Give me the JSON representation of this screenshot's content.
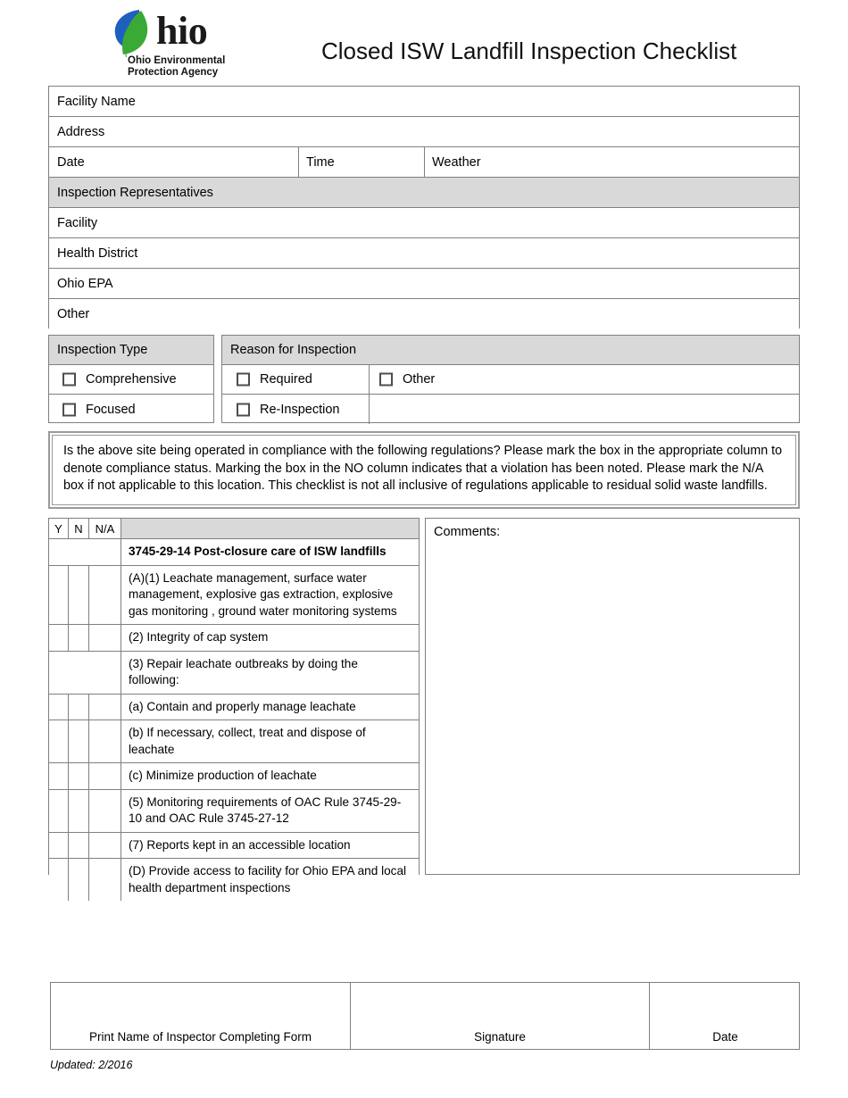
{
  "header": {
    "logo": {
      "wordmark": "hio",
      "agency_line1": "Ohio Environmental",
      "agency_line2": "Protection Agency",
      "leaf_blue": "#1f5fbf",
      "leaf_green": "#3aa935"
    },
    "title": "Closed ISW Landfill Inspection Checklist"
  },
  "facility_table": {
    "rows": [
      {
        "label": "Facility Name"
      },
      {
        "label": "Address"
      }
    ],
    "date_row": {
      "date_label": "Date",
      "time_label": "Time",
      "weather_label": "Weather"
    },
    "representatives_header": "Inspection Representatives",
    "representatives": [
      {
        "label": "Facility"
      },
      {
        "label": "Health District"
      },
      {
        "label": "Ohio EPA"
      },
      {
        "label": "Other"
      }
    ]
  },
  "inspection_type": {
    "header": "Inspection Type",
    "options": [
      {
        "label": "Comprehensive",
        "checked": false
      },
      {
        "label": "Focused",
        "checked": false
      }
    ]
  },
  "reason_for_inspection": {
    "header": "Reason for Inspection",
    "options_left": [
      {
        "label": "Required",
        "checked": false
      },
      {
        "label": "Re-Inspection",
        "checked": false
      }
    ],
    "options_right": [
      {
        "label": "Other",
        "checked": false
      }
    ]
  },
  "instructions": {
    "text": "Is the above site being operated  in compliance with the following regulations?  Please mark the box in the appropriate column to denote compliance status.  Marking the box in the NO column indicates that a violation has been noted.  Please mark the N/A box if not applicable to this location.  This checklist is not all inclusive of regulations applicable to residual solid waste landfills."
  },
  "checklist": {
    "columns": {
      "yes": "Y",
      "no": "N",
      "na": "N/A",
      "description": ""
    },
    "rows": [
      {
        "type": "section",
        "text": "3745-29-14 Post-closure care of ISW landfills",
        "yes": "",
        "no": "",
        "na": ""
      },
      {
        "type": "item",
        "text": "(A)(1) Leachate management, surface water management, explosive gas extraction, explosive gas monitoring , ground water monitoring systems",
        "yes": "",
        "no": "",
        "na": ""
      },
      {
        "type": "item",
        "text": "(2) Integrity of cap system",
        "yes": "",
        "no": "",
        "na": ""
      },
      {
        "type": "span",
        "text": "(3) Repair leachate outbreaks by doing the following:",
        "yes": "",
        "no": "",
        "na": ""
      },
      {
        "type": "item",
        "text": "(a) Contain and properly manage leachate",
        "yes": "",
        "no": "",
        "na": ""
      },
      {
        "type": "item",
        "text": "(b) If necessary, collect, treat and dispose of leachate",
        "yes": "",
        "no": "",
        "na": ""
      },
      {
        "type": "item",
        "text": "(c) Minimize production of leachate",
        "yes": "",
        "no": "",
        "na": ""
      },
      {
        "type": "item",
        "text": "(5) Monitoring requirements of OAC Rule 3745-29-10 and OAC Rule 3745-27-12",
        "yes": "",
        "no": "",
        "na": ""
      },
      {
        "type": "item",
        "text": "(7) Reports kept in an accessible location",
        "yes": "",
        "no": "",
        "na": ""
      },
      {
        "type": "item",
        "text": "(D) Provide access to facility for Ohio EPA and local health department inspections",
        "yes": "",
        "no": "",
        "na": ""
      }
    ]
  },
  "comments": {
    "label": "Comments:",
    "value": ""
  },
  "signature_block": {
    "print_name_caption": "Print Name of Inspector Completing Form",
    "print_name_value": "",
    "signature_caption": "Signature",
    "signature_value": "",
    "date_caption": "Date",
    "date_value": ""
  },
  "footer": {
    "updated": "Updated: 2/2016"
  }
}
